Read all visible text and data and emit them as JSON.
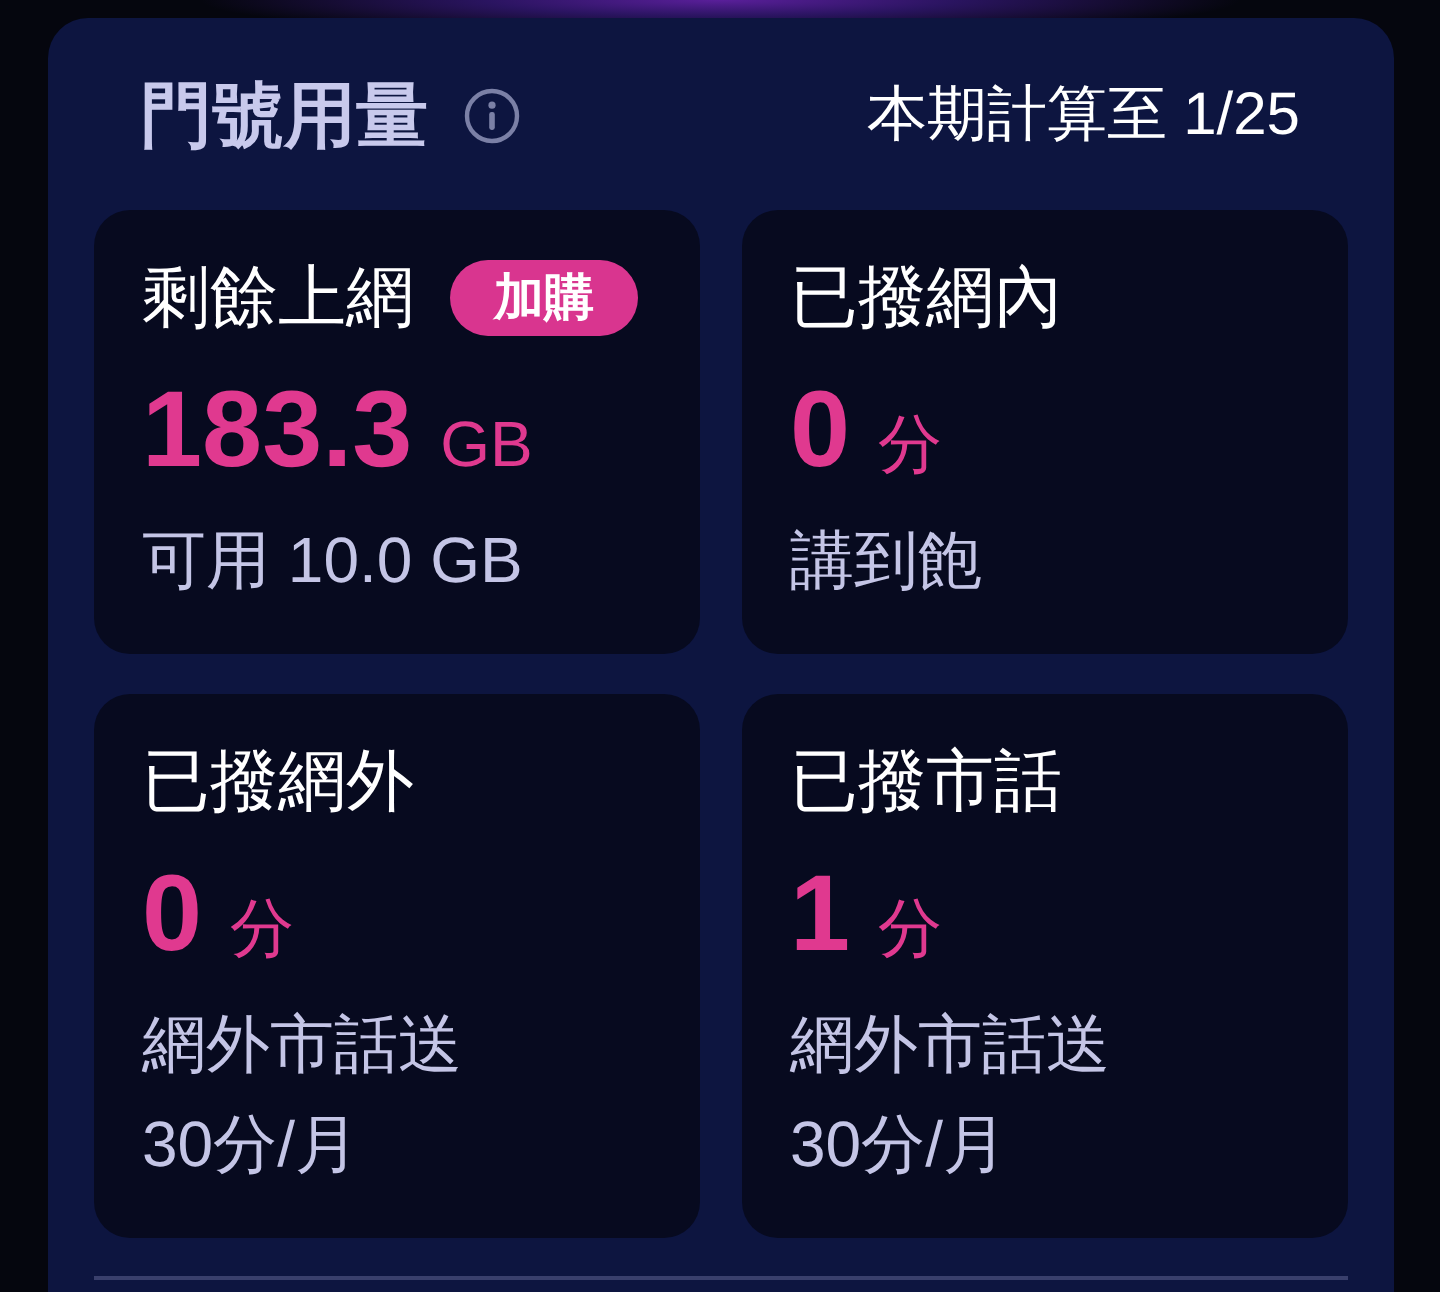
{
  "header": {
    "title": "門號用量",
    "period": "本期計算至 1/25"
  },
  "cards": [
    {
      "title": "剩餘上網",
      "badge": "加購",
      "value": "183.3",
      "unit": "GB",
      "note_lines": [
        "可用 10.0 GB"
      ]
    },
    {
      "title": "已撥網內",
      "value": "0",
      "unit": "分",
      "note_lines": [
        "講到飽"
      ]
    },
    {
      "title": "已撥網外",
      "value": "0",
      "unit": "分",
      "note_lines": [
        "網外市話送",
        "30分/月"
      ]
    },
    {
      "title": "已撥市話",
      "value": "1",
      "unit": "分",
      "note_lines": [
        "網外市話送",
        "30分/月"
      ]
    }
  ]
}
